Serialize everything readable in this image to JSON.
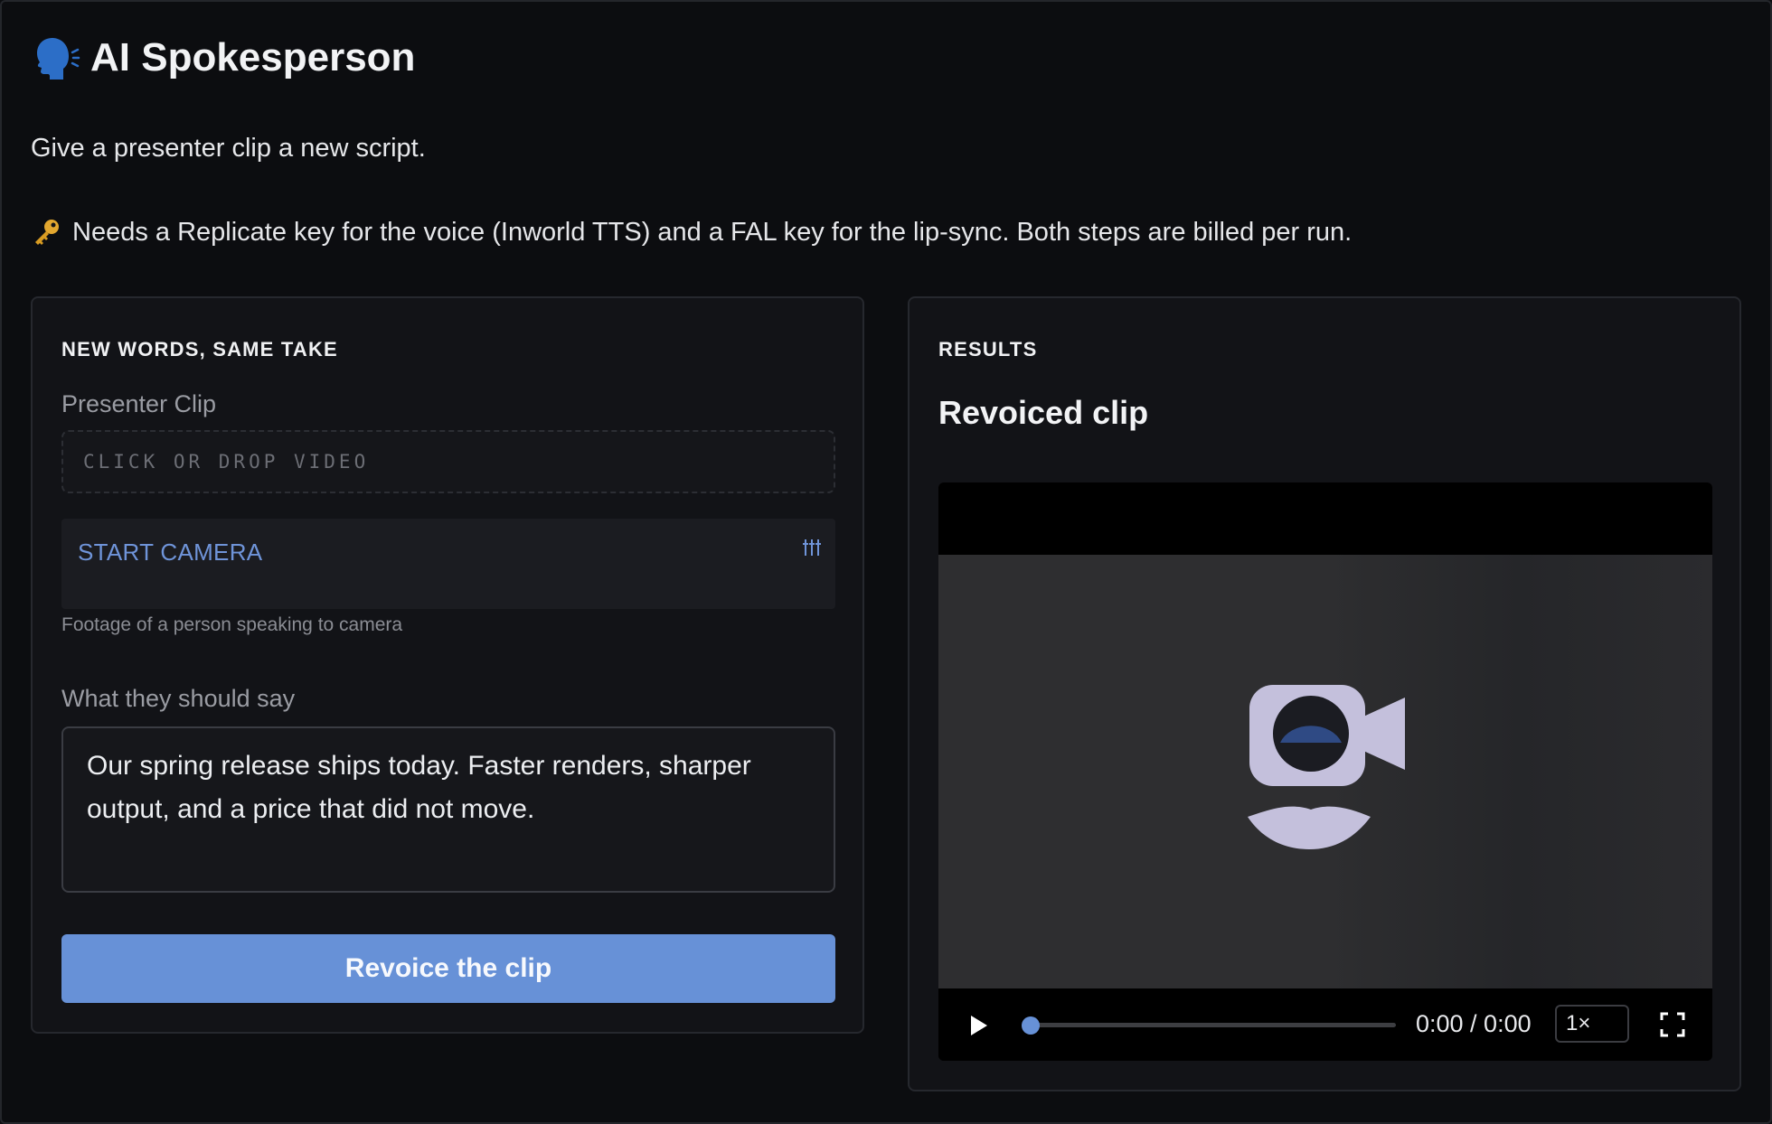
{
  "header": {
    "title": "AI Spokesperson",
    "subtitle": "Give a presenter clip a new script.",
    "note": "Needs a Replicate key for the voice (Inworld TTS) and a FAL key for the lip-sync. Both steps are billed per run."
  },
  "form": {
    "section_label": "NEW WORDS, SAME TAKE",
    "clip_label": "Presenter Clip",
    "dropzone_text": "CLICK OR DROP VIDEO",
    "camera_label": "START CAMERA",
    "clip_hint": "Footage of a person speaking to camera",
    "script_label": "What they should say",
    "script_value": "Our spring release ships today. Faster renders, sharper output, and a price that did not move.",
    "submit_label": "Revoice the clip"
  },
  "results": {
    "section_label": "RESULTS",
    "title": "Revoiced clip",
    "player": {
      "time": "0:00 / 0:00",
      "speed": "1×",
      "progress": 0
    }
  },
  "colors": {
    "accent": "#6791d7",
    "background": "#0c0d10",
    "panel": "#121317"
  },
  "icons": {
    "title": "speaking-head-icon",
    "note": "key-icon",
    "camera": "settings-sliders-icon",
    "play": "play-icon",
    "fullscreen": "fullscreen-icon"
  }
}
